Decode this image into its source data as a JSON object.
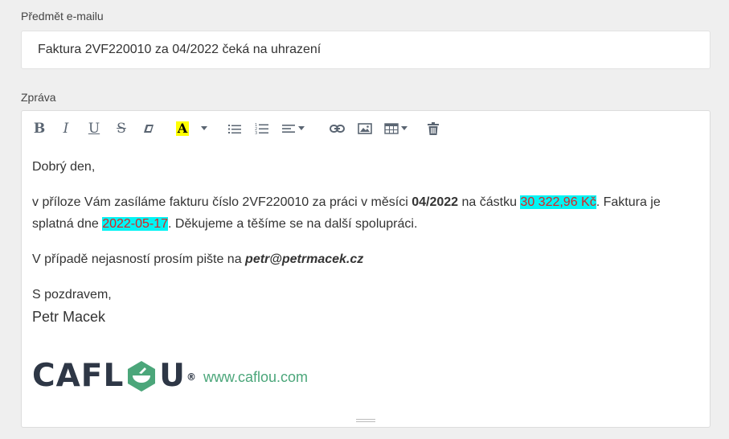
{
  "subject": {
    "label": "Předmět e-mailu",
    "value": "Faktura 2VF220010 za 04/2022 čeká na uhrazení"
  },
  "message": {
    "label": "Zpráva"
  },
  "toolbar": {
    "bold": "B",
    "italic": "I",
    "underline": "U",
    "strike": "S",
    "highlight_letter": "A",
    "highlight_color": "#ffff00",
    "icon_color": "#5a6572"
  },
  "body": {
    "greeting": "Dobrý den,",
    "p1_a": "v příloze Vám zasíláme fakturu číslo 2VF220010 za práci v měsíci ",
    "p1_month": "04/2022",
    "p1_b": " na částku ",
    "p1_amount": "30 322,96 Kč",
    "p1_c": ". Faktura je splatná dne ",
    "p1_date": "2022-05-17",
    "p1_d": ". Děkujeme a těšíme se na další spolupráci.",
    "p2_a": "V případě nejasností prosím pište na ",
    "p2_email": "petr@petrmacek.cz",
    "closing": "S pozdravem,",
    "name": "Petr Macek"
  },
  "logo": {
    "text_before": "CAFL",
    "text_after": "U",
    "registered": "®",
    "brand_color": "#4ba67a",
    "dark_color": "#2e3746",
    "url": "www.caflou.com"
  },
  "colors": {
    "highlight_bg": "#00f4f4",
    "highlight_text": "#e02020"
  }
}
